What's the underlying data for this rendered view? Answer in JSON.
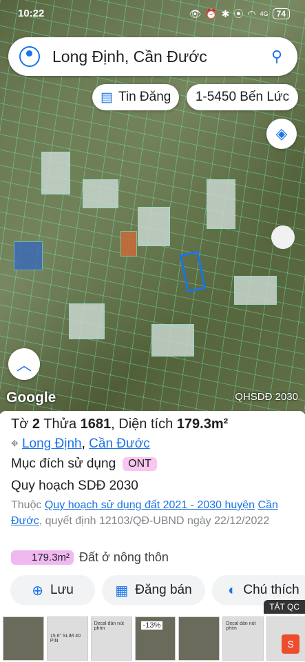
{
  "status": {
    "time": "10:22",
    "battery": "74",
    "signal": "4G"
  },
  "search": {
    "query": "Long Định, Cần Đước",
    "account_icon": "account-circle-icon",
    "search_icon": "search-icon"
  },
  "chips": [
    {
      "label": "Tin Đăng",
      "icon": "list-icon"
    },
    {
      "label": "1-5450 Bến Lức"
    }
  ],
  "map": {
    "brand": "Google",
    "overlay_label": "QHSDĐ 2030"
  },
  "parcel": {
    "to_label": "Tờ",
    "to_value": "2",
    "thua_label": "Thửa",
    "thua_value": "1681",
    "dt_label": "Diện tích",
    "dt_value": "179.3m²",
    "commune": "Long Định",
    "district": "Cần Đước",
    "purpose_label": "Mục đích sử dụng",
    "purpose_code": "ONT",
    "plan_title": "Quy hoạch SDĐ 2030",
    "belongs_prefix": "Thuộc",
    "plan_link": "Quy hoạch sử dụng đất 2021 - 2030 huyện",
    "plan_link2": "Cần Đước",
    "decision": ", quyết định 12103/QĐ-UBND ngày",
    "date": "22/12/2022",
    "area_badge": "179.3m²",
    "area_desc": "Đất ở nông thôn"
  },
  "actions": [
    {
      "label": "Lưu",
      "icon": "bookmark-add-icon"
    },
    {
      "label": "Đăng bán",
      "icon": "listing-icon"
    },
    {
      "label": "Chú thích",
      "icon": "contrast-icon"
    }
  ],
  "ads": {
    "close_label": "TẮT QC",
    "thumb1": "15.6\" SLIM 40 PIN",
    "thumb2": "Decal dán nút phím",
    "thumb3": "-13%",
    "thumb4": "Decal dán nút phím"
  }
}
